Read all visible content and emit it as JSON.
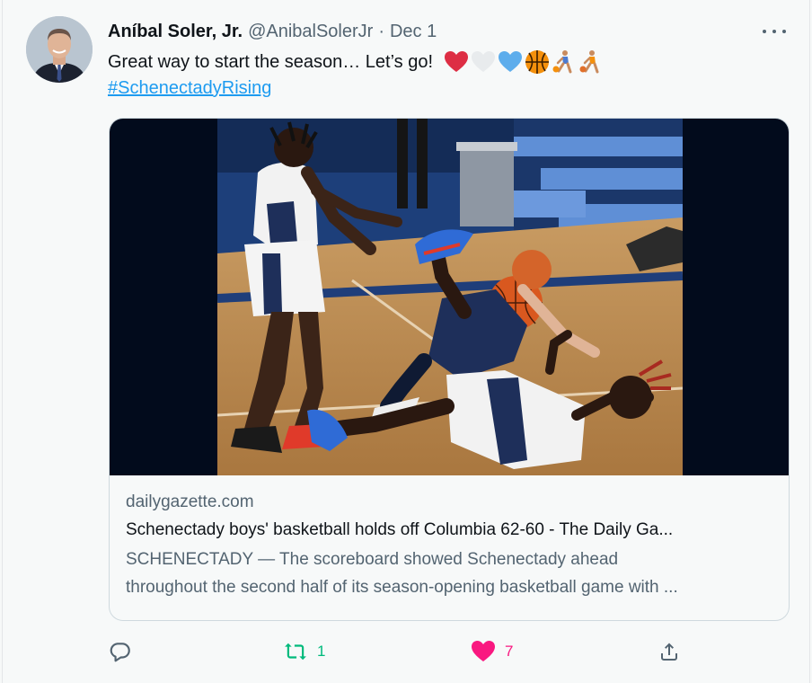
{
  "author": {
    "name": "Aníbal Soler, Jr.",
    "handle": "@AnibalSolerJr",
    "separator": "·",
    "date": "Dec 1"
  },
  "tweet": {
    "text": "Great way to start the season… Let’s go!",
    "hashtag": "#SchenectadyRising",
    "emoji_icons": [
      "red-heart-icon",
      "white-heart-icon",
      "blue-heart-icon",
      "basketball-icon",
      "person-bouncing-ball-icon",
      "person-bouncing-ball-icon"
    ]
  },
  "card": {
    "domain": "dailygazette.com",
    "title": "Schenectady boys' basketball holds off Columbia 62-60 - The Daily Ga...",
    "description_line1": "SCHENECTADY — The scoreboard showed Schenectady ahead",
    "description_line2": "throughout the second half of its season-opening basketball game with ..."
  },
  "actions": {
    "reply_icon": "reply-icon",
    "retweet_icon": "retweet-icon",
    "retweet_count": "1",
    "like_icon": "heart-icon",
    "like_count": "7",
    "share_icon": "share-icon"
  },
  "colors": {
    "link": "#1d9bf0",
    "secondary_text": "#536471",
    "retweet": "#00ba7c",
    "like": "#f91880"
  }
}
